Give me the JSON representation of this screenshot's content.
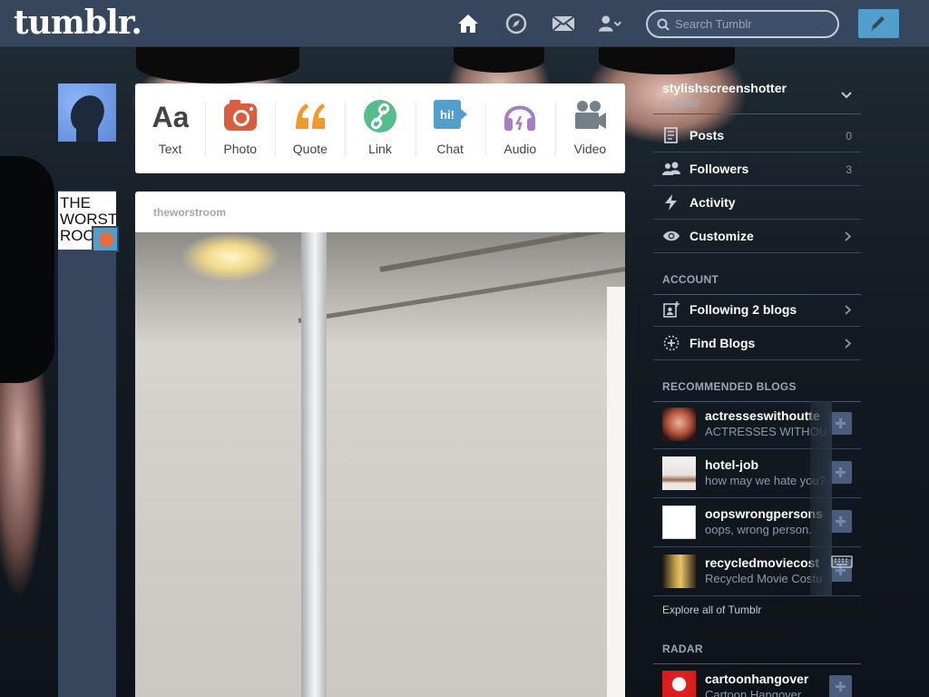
{
  "header": {
    "logo": "tumblr.",
    "search_placeholder": "Search Tumblr"
  },
  "post_types": [
    {
      "label": "Text",
      "icon": "text-icon",
      "color": "#444444"
    },
    {
      "label": "Photo",
      "icon": "camera-icon",
      "color": "#d95e40"
    },
    {
      "label": "Quote",
      "icon": "quote-icon",
      "color": "#f2992e"
    },
    {
      "label": "Link",
      "icon": "link-icon",
      "color": "#56bc8a"
    },
    {
      "label": "Chat",
      "icon": "chat-icon",
      "color": "#529ecc"
    },
    {
      "label": "Audio",
      "icon": "headphones-icon",
      "color": "#a77dc2"
    },
    {
      "label": "Video",
      "icon": "video-camera-icon",
      "color": "#748089"
    }
  ],
  "post": {
    "author": "theworstroom",
    "avatar_text": "THE WORST ROO"
  },
  "sidebar": {
    "blog_name": "stylishscreenshotter",
    "blog_subtitle": "Untitled",
    "stats": [
      {
        "label": "Posts",
        "count": "0",
        "icon": "posts-icon"
      },
      {
        "label": "Followers",
        "count": "3",
        "icon": "followers-icon"
      },
      {
        "label": "Activity",
        "count": "",
        "icon": "lightning-icon"
      },
      {
        "label": "Customize",
        "count": "",
        "icon": "eye-icon"
      }
    ],
    "account_title": "ACCOUNT",
    "account_items": [
      {
        "label": "Following 2 blogs",
        "icon": "following-icon"
      },
      {
        "label": "Find Blogs",
        "icon": "find-blogs-icon"
      }
    ],
    "recommended_title": "RECOMMENDED BLOGS",
    "recommended": [
      {
        "name": "actresseswithoutte",
        "desc": "ACTRESSES WITHOUT"
      },
      {
        "name": "hotel-job",
        "desc": "how may we hate you?"
      },
      {
        "name": "oopswrongpersons",
        "desc": "oops, wrong person."
      },
      {
        "name": "recycledmoviecost",
        "desc": "Recycled Movie Costu"
      }
    ],
    "explore": "Explore all of Tumblr",
    "radar_title": "RADAR",
    "radar": [
      {
        "name": "cartoonhangover",
        "desc": "Cartoon Hangover"
      }
    ]
  },
  "colors": {
    "header_bg": "#36465d",
    "accent_blue": "#529ecc"
  }
}
